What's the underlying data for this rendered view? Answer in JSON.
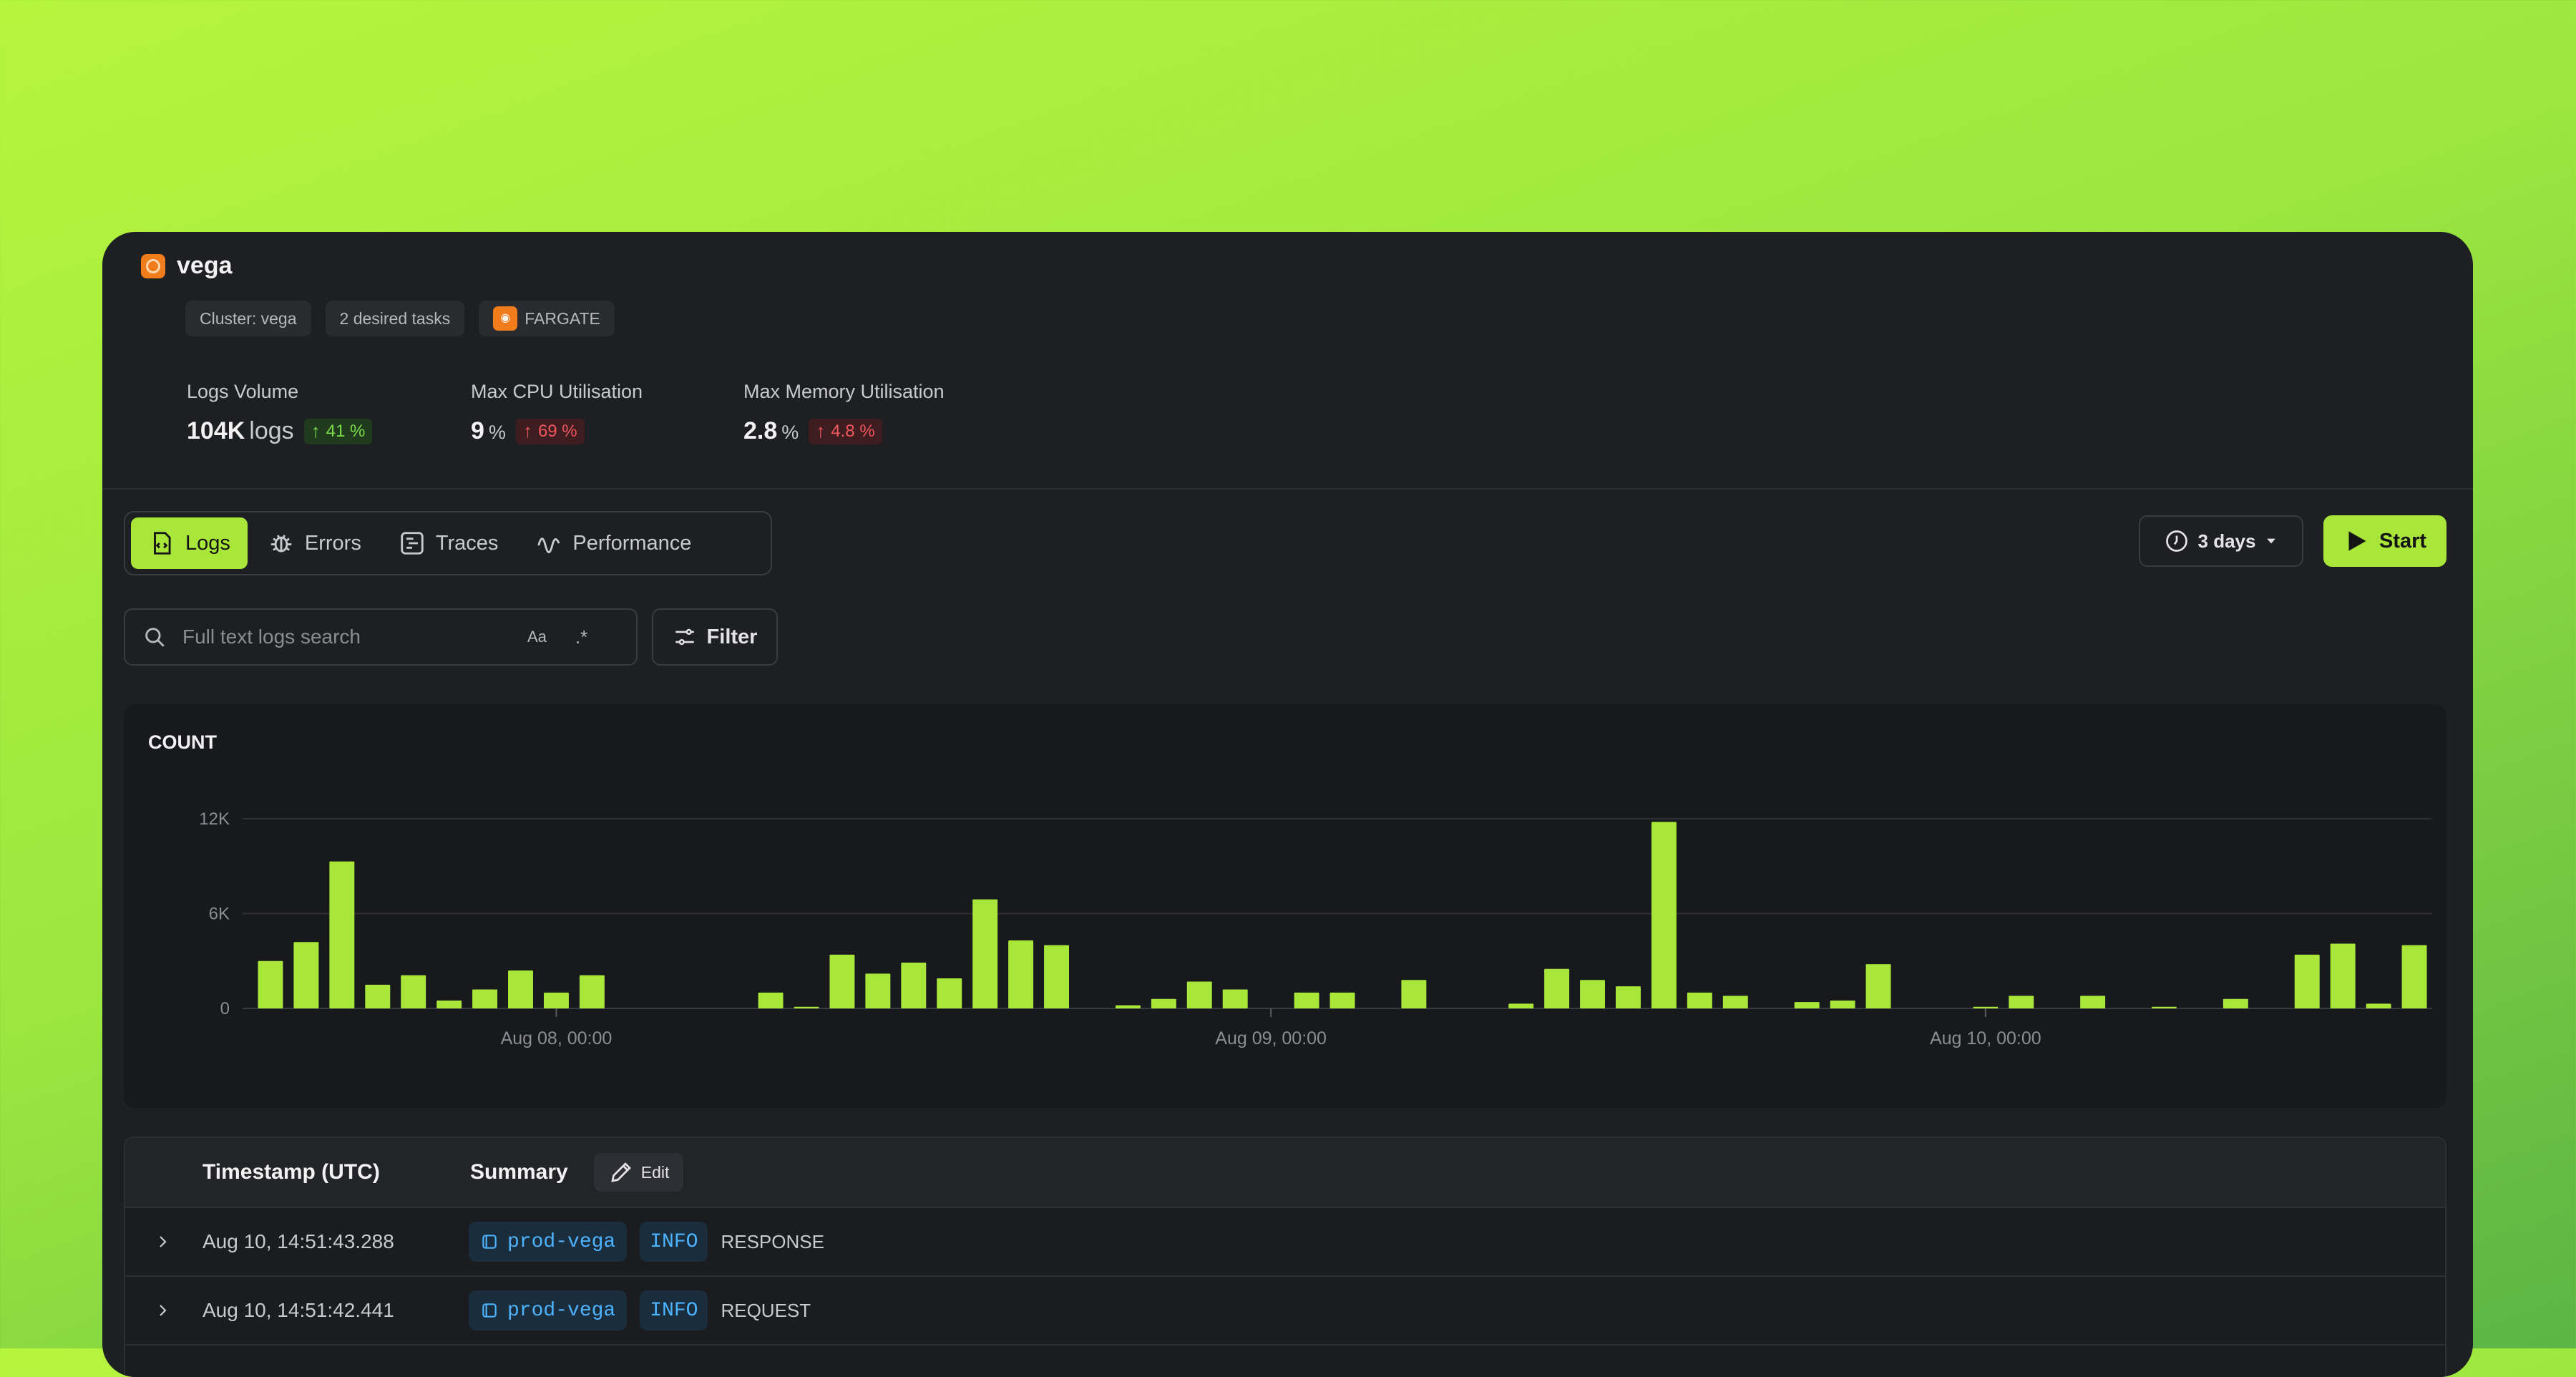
{
  "service": {
    "name": "vega"
  },
  "chips": {
    "cluster": "Cluster: vega",
    "tasks": "2 desired tasks",
    "launch_type": "FARGATE"
  },
  "metrics": [
    {
      "label": "Logs Volume",
      "value": "104K",
      "unit": "logs",
      "change": "41 %",
      "direction": "up",
      "status": "good"
    },
    {
      "label": "Max CPU Utilisation",
      "value": "9",
      "unit": "%",
      "change": "69 %",
      "direction": "up",
      "status": "bad"
    },
    {
      "label": "Max Memory Utilisation",
      "value": "2.8",
      "unit": "%",
      "change": "4.8 %",
      "direction": "up",
      "status": "bad"
    }
  ],
  "tabs": [
    {
      "label": "Logs",
      "icon": "logs-icon",
      "active": true
    },
    {
      "label": "Errors",
      "icon": "bug-icon",
      "active": false
    },
    {
      "label": "Traces",
      "icon": "traces-icon",
      "active": false
    },
    {
      "label": "Performance",
      "icon": "pulse-icon",
      "active": false
    }
  ],
  "toolbar": {
    "time_range": "3 days",
    "start_label": "Start"
  },
  "search": {
    "placeholder": "Full text logs search",
    "case_label": "Aa",
    "regex_label": ".*",
    "filter_label": "Filter"
  },
  "colors": {
    "accent": "#a8e63a",
    "panel": "#1e1f22",
    "good": "#7ddc4e",
    "bad": "#f0575e",
    "tag": "#4db3ff"
  },
  "chart_data": {
    "type": "bar",
    "title": "COUNT",
    "ylim": [
      0,
      12000
    ],
    "yticks": [
      {
        "value": 0,
        "label": "0"
      },
      {
        "value": 6000,
        "label": "6K"
      },
      {
        "value": 12000,
        "label": "12K"
      }
    ],
    "xticks": [
      {
        "index": 8.5,
        "label": "Aug 08, 00:00"
      },
      {
        "index": 28.5,
        "label": "Aug 09, 00:00"
      },
      {
        "index": 48.5,
        "label": "Aug 10, 00:00"
      }
    ],
    "values": [
      3000,
      4200,
      9300,
      1500,
      2100,
      500,
      1200,
      2400,
      1000,
      2100,
      0,
      0,
      0,
      0,
      1000,
      100,
      3400,
      2200,
      2900,
      1900,
      6900,
      4300,
      4000,
      0,
      200,
      600,
      1700,
      1200,
      0,
      1000,
      1000,
      0,
      1800,
      0,
      0,
      300,
      2500,
      1800,
      1400,
      11800,
      1000,
      800,
      0,
      400,
      500,
      2800,
      0,
      0,
      100,
      800,
      0,
      800,
      0,
      100,
      0,
      600,
      0,
      3400,
      4100,
      300,
      4000
    ],
    "grid": true
  },
  "table": {
    "columns": {
      "timestamp": "Timestamp (UTC)",
      "summary": "Summary",
      "edit": "Edit"
    },
    "rows": [
      {
        "timestamp": "Aug 10, 14:51:43.288",
        "service": "prod-vega",
        "level": "INFO",
        "message": "RESPONSE"
      },
      {
        "timestamp": "Aug 10, 14:51:42.441",
        "service": "prod-vega",
        "level": "INFO",
        "message": "REQUEST"
      }
    ]
  }
}
